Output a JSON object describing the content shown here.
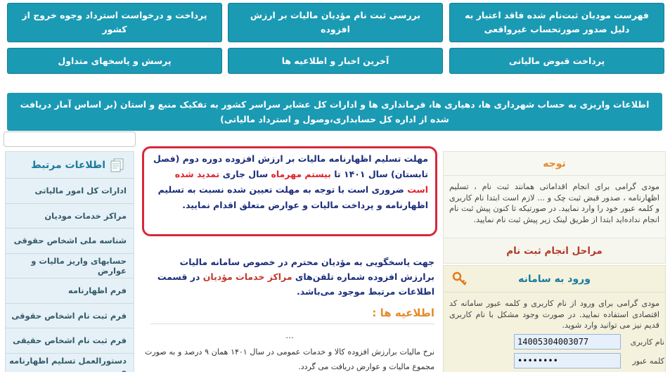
{
  "tiles": {
    "row1": [
      {
        "label": "فهرست مودیان ثبت‌نام شده فاقد اعتبار به دلیل صدور صورتحساب غیرواقعی"
      },
      {
        "label": "بررسی ثبت نام مؤدیان مالیات بر ارزش افزوده"
      },
      {
        "label": "پرداخت و درخواست استرداد وجوه خروج از کشور"
      }
    ],
    "row2": [
      {
        "label": "پرداخت قبوض مالیاتی"
      },
      {
        "label": "آخرین اخبار و اطلاعیه ها"
      },
      {
        "label": "پرسش و پاسخهای متداول"
      }
    ]
  },
  "banner": {
    "label": "اطلاعات واریزی به حساب شهرداری ها، دهیاری ها، فرمانداری ها و ادارات کل عشایر سراسر کشور به تفکیک منبع و استان (بر اساس آمار دریافت شده  از اداره کل حسابداری،وصول و استرداد مالیاتی)"
  },
  "search": {
    "placeholder": ""
  },
  "related": {
    "title": "اطلاعات مرتبط",
    "items": [
      "ادارات کل امور مالیاتی",
      "مراکز خدمات مودیان",
      "شناسه ملی اشخاص حقوقی",
      "حسابهای واریز مالیات و عوارض",
      "فرم اظهارنامه",
      "فرم ثبت نام اشخاص حقوقی",
      "فرم ثبت نام اشخاص حقیقی",
      "دستورالعمل تسلیم اظهارنامه و"
    ]
  },
  "notice": {
    "line1": "مهلت تسلیم اظهارنامه مالیات بر ارزش افزوده دوره دوم (فصل تابستان) سال ۱۴۰۱ تا",
    "deadline": "بیستم مهرماه",
    "mid": " سال جاری ",
    "extended": "تمدید شده است",
    "rest": " ضروری است با توجه به مهلت تعیین شده نسبت به تسلیم اظهارنامه و پرداخت مالیات و عوارض متعلق اقدام نمایید."
  },
  "phones": {
    "part1": "جهت پاسخگویی به مؤدیان محترم در خصوص سامانه مالیات برارزش افزوده شماره تلفن‌های ",
    "org": "مراکز خدمات مؤدیان",
    "part2": " در قسمت اطلاعات مرتبط موجود می‌باشد."
  },
  "news": {
    "title": "اطلاعیه ها :",
    "dots": "...",
    "body": "نرخ مالیات برارزش افزوده کالا و خدمات عمومی در سال ۱۴۰۱ همان ۹ درصد و به صورت مجموع مالیات و عوارض دریافت می گردد."
  },
  "attention": {
    "title": "توجه",
    "body": "مودی گرامی برای انجام اقداماتی همانند ثبت نام ، تسلیم اظهارنامه ، صدور قبض ثبت چک و ... لازم است ابتدا نام کاربری و کلمه عبور خود را وارد نمایید. در صورتیکه تا کنون پیش ثبت نام انجام نداده‌اید ابتدا از طریق لینک زیر پیش ثبت نام نمایید."
  },
  "steps": {
    "label": "مراحل انجام ثبت نام"
  },
  "login": {
    "title": "ورود به سامانه",
    "body": "مودی گرامی برای ورود از نام کاربری و کلمه عبور سامانه کد اقتصادی استفاده نمایید. در صورت وجود مشکل با نام کاربری قدیم نیز می توانید وارد شوید.",
    "username_label": "نام کاربری",
    "username_value": "14005304003077",
    "password_label": "کلمه عبور",
    "password_value": "••••••••"
  }
}
